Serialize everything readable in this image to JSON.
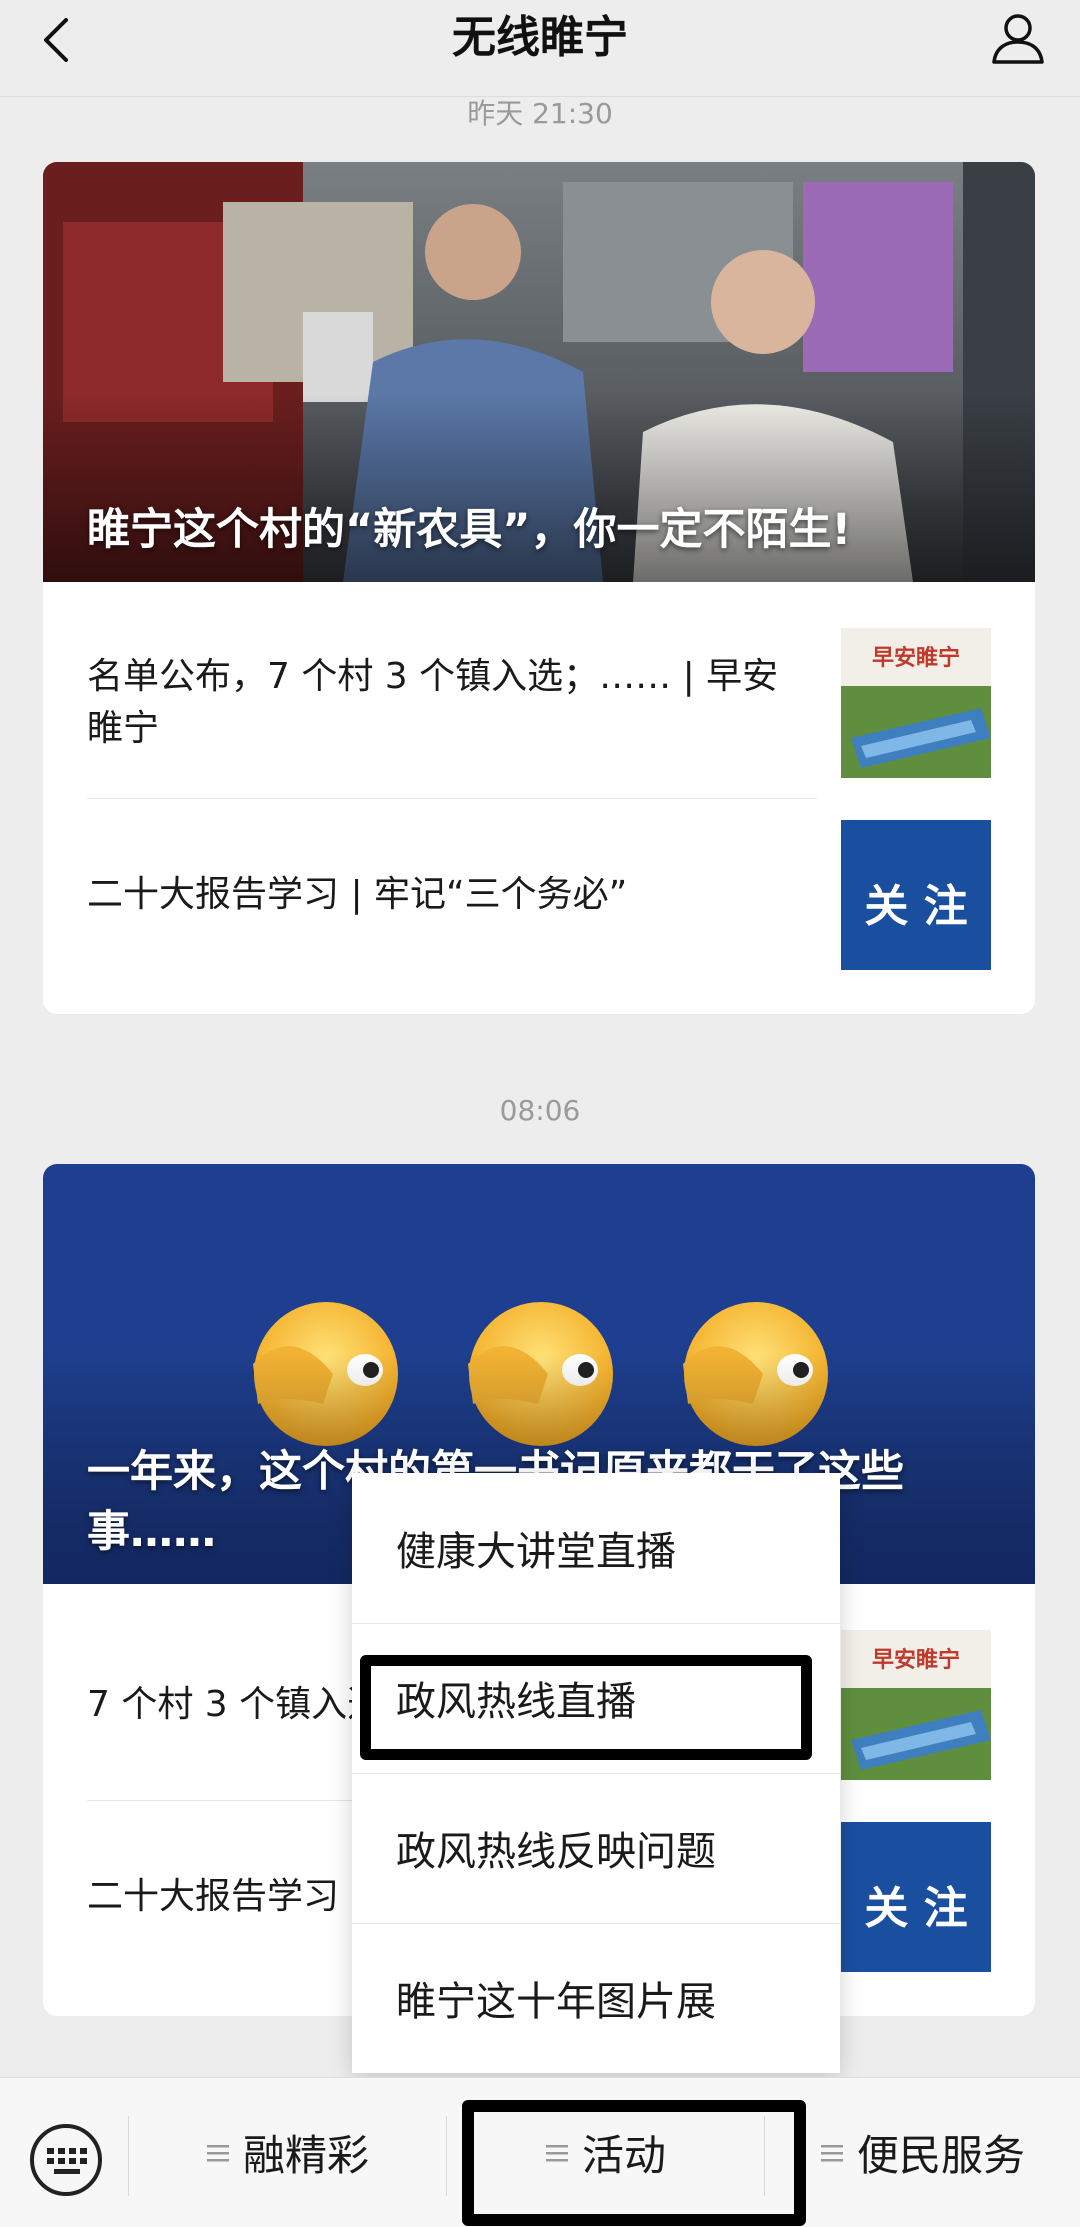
{
  "header": {
    "title": "无线睢宁"
  },
  "feed": [
    {
      "time": "昨天 21:30",
      "hero_title": "睢宁这个村的“新农具”，你一定不陌生!",
      "items": [
        {
          "text": "名单公布，7 个村 3 个镇入选；…… | 早安睢宁",
          "thumb_text": "早安睢宁"
        },
        {
          "text": "二十大报告学习 | 牢记“三个务必”",
          "thumb_text": "关 注"
        }
      ]
    },
    {
      "time": "08:06",
      "hero_title": "一年来，这个村的第一书记原来都干了这些事……",
      "items": [
        {
          "text": "7 个村 3 个镇入选；…… | 早安睢宁",
          "thumb_text": "早安睢宁"
        },
        {
          "text": "二十大报告学习 | 牢记“三个务必”",
          "thumb_text": "关 注"
        }
      ]
    }
  ],
  "popup_menu": {
    "items": [
      "健康大讲堂直播",
      "政风热线直播",
      "政风热线反映问题",
      "睢宁这十年图片展"
    ],
    "highlighted_index": 1
  },
  "bottom_menu": {
    "items": [
      "融精彩",
      "活动",
      "便民服务"
    ],
    "highlighted_index": 1
  },
  "colors": {
    "background": "#ededed",
    "card": "#ffffff",
    "hero2_blue": "#1e3f8f",
    "thumb_blue": "#1a4fa0"
  },
  "icons": [
    "back-arrow-icon",
    "person-icon",
    "keyboard-icon",
    "menu-lines-icon",
    "emoji-face-covering-eye-icon"
  ]
}
